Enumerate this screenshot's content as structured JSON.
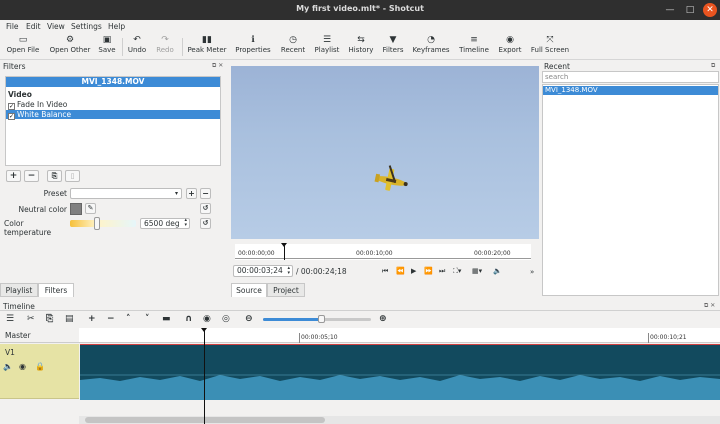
{
  "window": {
    "title": "My first video.mlt* - Shotcut"
  },
  "menu": {
    "items": [
      "File",
      "Edit",
      "View",
      "Settings",
      "Help"
    ]
  },
  "toolbar": {
    "items": [
      {
        "label": "Open File",
        "icon": "open-file-icon"
      },
      {
        "label": "Open Other",
        "icon": "open-other-icon"
      },
      {
        "label": "Save",
        "icon": "save-icon"
      },
      {
        "label": "Undo",
        "icon": "undo-icon"
      },
      {
        "label": "Redo",
        "icon": "redo-icon"
      },
      {
        "label": "Peak Meter",
        "icon": "peak-meter-icon"
      },
      {
        "label": "Properties",
        "icon": "properties-icon"
      },
      {
        "label": "Recent",
        "icon": "recent-icon"
      },
      {
        "label": "Playlist",
        "icon": "playlist-icon"
      },
      {
        "label": "History",
        "icon": "history-icon"
      },
      {
        "label": "Filters",
        "icon": "filters-icon"
      },
      {
        "label": "Keyframes",
        "icon": "keyframes-icon"
      },
      {
        "label": "Timeline",
        "icon": "timeline-icon"
      },
      {
        "label": "Export",
        "icon": "export-icon"
      },
      {
        "label": "Full Screen",
        "icon": "fullscreen-icon"
      }
    ]
  },
  "filters": {
    "title": "Filters",
    "clip_name": "MVI_1348.MOV",
    "group": "Video",
    "items": [
      {
        "label": "Fade In Video",
        "checked": true,
        "selected": false
      },
      {
        "label": "White Balance",
        "checked": true,
        "selected": true
      }
    ],
    "preset_label": "Preset",
    "preset_value": "",
    "neutral_color_label": "Neutral color",
    "neutral_color": "#808080",
    "color_temp_label": "Color temperature",
    "color_temp_value": "6500 deg"
  },
  "left_tabs": [
    "Playlist",
    "Filters"
  ],
  "left_active_tab": "Filters",
  "player": {
    "ruler_ticks": [
      "00:00:00;00",
      "00:00:10;00",
      "00:00:20;00"
    ],
    "position": "00:00:03;24",
    "duration": "/ 00:00:24;18",
    "tabs": [
      "Source",
      "Project"
    ],
    "active_tab": "Source"
  },
  "recent": {
    "title": "Recent",
    "search_placeholder": "search",
    "items": [
      "MVI_1348.MOV"
    ]
  },
  "timeline": {
    "title": "Timeline",
    "master_label": "Master",
    "track_label": "V1",
    "ruler_ticks": [
      "00:00:05;10",
      "00:00:10;21"
    ]
  },
  "colors": {
    "selection": "#3d8bd6",
    "clip": "#124a5e",
    "waveform": "#3b8fb5",
    "track_header": "#e6e3a5",
    "accent": "#e95420"
  }
}
